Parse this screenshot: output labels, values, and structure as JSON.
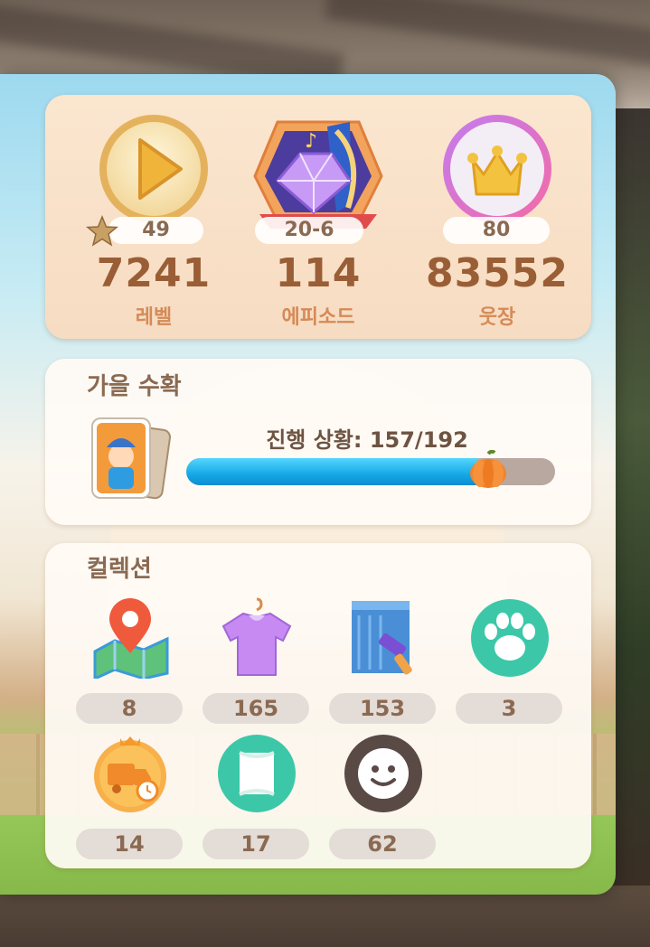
{
  "stats": [
    {
      "badge": "49",
      "value": "7241",
      "label": "레벨",
      "icon": "play-icon"
    },
    {
      "badge": "20-6",
      "value": "114",
      "label": "에피소드",
      "icon": "gem-harp-icon"
    },
    {
      "badge": "80",
      "value": "83552",
      "label": "웃장",
      "icon": "crown-icon"
    }
  ],
  "event": {
    "title": "가을 수확",
    "progress_text": "진행 상황: 157/192",
    "progress_current": 157,
    "progress_total": 192,
    "icon": "character-cards-icon",
    "bar_end_icon": "pumpkin-icon"
  },
  "collection": {
    "title": "컬렉션",
    "items": [
      {
        "icon": "map-pin-icon",
        "count": "8"
      },
      {
        "icon": "shirt-icon",
        "count": "165"
      },
      {
        "icon": "paint-roller-icon",
        "count": "153"
      },
      {
        "icon": "paw-icon",
        "count": "3"
      },
      {
        "icon": "delivery-truck-icon",
        "count": "14"
      },
      {
        "icon": "frame-icon",
        "count": "17"
      },
      {
        "icon": "smiley-face-icon",
        "count": "62"
      }
    ]
  },
  "colors": {
    "accent_text": "#9a5e36",
    "label_text": "#d58a57",
    "progress_fill": "#14a8e6"
  }
}
